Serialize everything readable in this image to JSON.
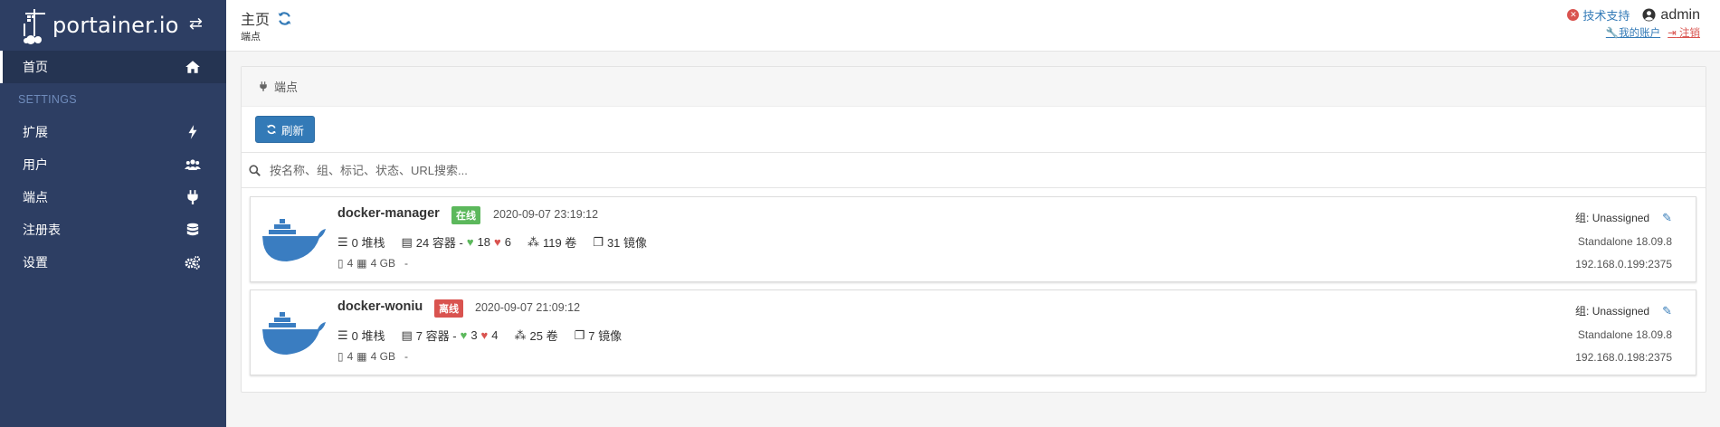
{
  "brand": {
    "name": "portainer.io"
  },
  "sidebar": {
    "items": [
      {
        "label": "首页",
        "icon": "home-icon"
      },
      {
        "section": "SETTINGS"
      },
      {
        "label": "扩展",
        "icon": "bolt-icon"
      },
      {
        "label": "用户",
        "icon": "users-icon"
      },
      {
        "label": "端点",
        "icon": "plug-icon"
      },
      {
        "label": "注册表",
        "icon": "database-icon"
      },
      {
        "label": "设置",
        "icon": "cogs-icon"
      }
    ]
  },
  "header": {
    "title": "主页",
    "breadcrumb": "端点",
    "support": "技术支持",
    "user": "admin",
    "my_account": "我的账户",
    "logout": "注销"
  },
  "panel": {
    "title": "端点",
    "refresh_label": "刷新",
    "search_placeholder": "按名称、组、标记、状态、URL搜索..."
  },
  "endpoints": [
    {
      "name": "docker-manager",
      "status": "在线",
      "timestamp": "2020-09-07 23:19:12",
      "stacks": "0 堆栈",
      "containers": "24 容器 -",
      "healthy": "18",
      "unhealthy": "6",
      "volumes": "119 卷",
      "images": "31 镜像",
      "cpu": "4",
      "memory": "4 GB",
      "dash": "-",
      "group": "组: Unassigned",
      "version": "Standalone 18.09.8",
      "url": "192.168.0.199:2375"
    },
    {
      "name": "docker-woniu",
      "status": "离线",
      "timestamp": "2020-09-07 21:09:12",
      "stacks": "0 堆栈",
      "containers": "7 容器 -",
      "healthy": "3",
      "unhealthy": "4",
      "volumes": "25 卷",
      "images": "7 镜像",
      "cpu": "4",
      "memory": "4 GB",
      "dash": "-",
      "group": "组: Unassigned",
      "version": "Standalone 18.09.8",
      "url": "192.168.0.198:2375"
    }
  ],
  "colors": {
    "sidebar_bg": "#2d3e63",
    "primary": "#337ab7",
    "online": "#5cb85c",
    "offline": "#d9534f"
  }
}
